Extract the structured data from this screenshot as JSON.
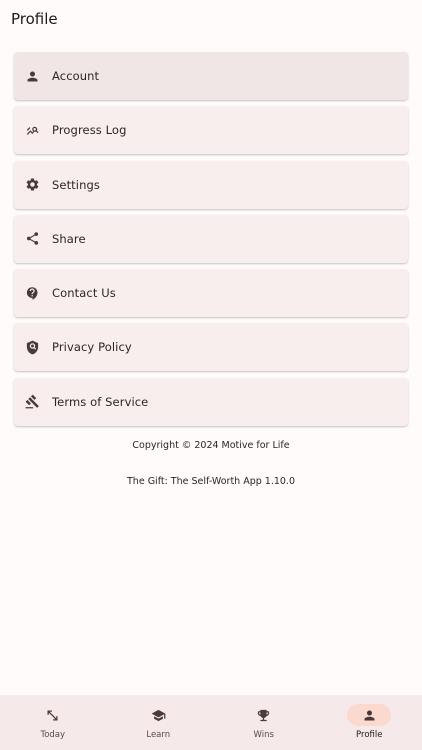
{
  "header": {
    "title": "Profile"
  },
  "menu": [
    {
      "label": "Account",
      "icon": "person-icon"
    },
    {
      "label": "Progress Log",
      "icon": "trending-search-icon"
    },
    {
      "label": "Settings",
      "icon": "gear-icon"
    },
    {
      "label": "Share",
      "icon": "share-icon"
    },
    {
      "label": "Contact Us",
      "icon": "contact-support-icon"
    },
    {
      "label": "Privacy Policy",
      "icon": "privacy-shield-icon"
    },
    {
      "label": "Terms of Service",
      "icon": "gavel-icon"
    }
  ],
  "footer": {
    "copyright": "Copyright © 2024 Motive for Life",
    "version": "The Gift: The Self-Worth App 1.10.0"
  },
  "bottom_nav": [
    {
      "label": "Today",
      "icon": "arrows-diagonal-icon"
    },
    {
      "label": "Learn",
      "icon": "school-cap-icon"
    },
    {
      "label": "Wins",
      "icon": "trophy-icon"
    },
    {
      "label": "Profile",
      "icon": "person-icon",
      "active": true
    }
  ],
  "colors": {
    "background": "#fffbfb",
    "card": "#f8eeee",
    "nav_background": "#f5e9e9",
    "nav_active_pill": "#fbd9cf",
    "icon": "#4a3a3a"
  }
}
